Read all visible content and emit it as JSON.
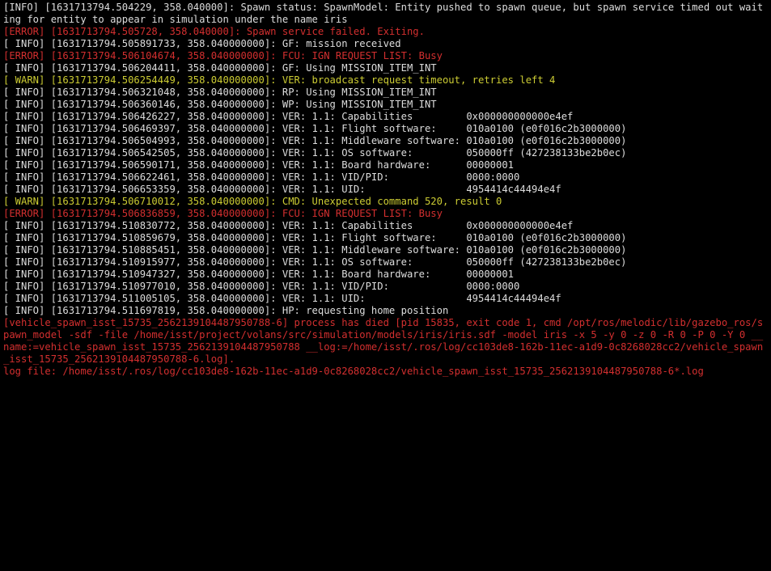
{
  "lines": [
    {
      "cls": "info",
      "text": "[INFO] [1631713794.504229, 358.040000]: Spawn status: SpawnModel: Entity pushed to spawn queue, but spawn service timed out waiting for entity to appear in simulation under the name iris"
    },
    {
      "cls": "error",
      "text": "[ERROR] [1631713794.505728, 358.040000]: Spawn service failed. Exiting."
    },
    {
      "cls": "info",
      "text": "[ INFO] [1631713794.505891733, 358.040000000]: GF: mission received"
    },
    {
      "cls": "error",
      "text": "[ERROR] [1631713794.506104674, 358.040000000]: FCU: IGN REQUEST LIST: Busy"
    },
    {
      "cls": "info",
      "text": "[ INFO] [1631713794.506204411, 358.040000000]: GF: Using MISSION_ITEM_INT"
    },
    {
      "cls": "warn",
      "text": "[ WARN] [1631713794.506254449, 358.040000000]: VER: broadcast request timeout, retries left 4"
    },
    {
      "cls": "info",
      "text": "[ INFO] [1631713794.506321048, 358.040000000]: RP: Using MISSION_ITEM_INT"
    },
    {
      "cls": "info",
      "text": "[ INFO] [1631713794.506360146, 358.040000000]: WP: Using MISSION_ITEM_INT"
    },
    {
      "cls": "info",
      "text": "[ INFO] [1631713794.506426227, 358.040000000]: VER: 1.1: Capabilities         0x000000000000e4ef"
    },
    {
      "cls": "info",
      "text": "[ INFO] [1631713794.506469397, 358.040000000]: VER: 1.1: Flight software:     010a0100 (e0f016c2b3000000)"
    },
    {
      "cls": "info",
      "text": "[ INFO] [1631713794.506504993, 358.040000000]: VER: 1.1: Middleware software: 010a0100 (e0f016c2b3000000)"
    },
    {
      "cls": "info",
      "text": "[ INFO] [1631713794.506542505, 358.040000000]: VER: 1.1: OS software:         050000ff (427238133be2b0ec)"
    },
    {
      "cls": "info",
      "text": "[ INFO] [1631713794.506590171, 358.040000000]: VER: 1.1: Board hardware:      00000001"
    },
    {
      "cls": "info",
      "text": "[ INFO] [1631713794.506622461, 358.040000000]: VER: 1.1: VID/PID:             0000:0000"
    },
    {
      "cls": "info",
      "text": "[ INFO] [1631713794.506653359, 358.040000000]: VER: 1.1: UID:                 4954414c44494e4f"
    },
    {
      "cls": "warn",
      "text": "[ WARN] [1631713794.506710012, 358.040000000]: CMD: Unexpected command 520, result 0"
    },
    {
      "cls": "error",
      "text": "[ERROR] [1631713794.506836859, 358.040000000]: FCU: IGN REQUEST LIST: Busy"
    },
    {
      "cls": "info",
      "text": "[ INFO] [1631713794.510830772, 358.040000000]: VER: 1.1: Capabilities         0x000000000000e4ef"
    },
    {
      "cls": "info",
      "text": "[ INFO] [1631713794.510859679, 358.040000000]: VER: 1.1: Flight software:     010a0100 (e0f016c2b3000000)"
    },
    {
      "cls": "info",
      "text": "[ INFO] [1631713794.510885451, 358.040000000]: VER: 1.1: Middleware software: 010a0100 (e0f016c2b3000000)"
    },
    {
      "cls": "info",
      "text": "[ INFO] [1631713794.510915977, 358.040000000]: VER: 1.1: OS software:         050000ff (427238133be2b0ec)"
    },
    {
      "cls": "info",
      "text": "[ INFO] [1631713794.510947327, 358.040000000]: VER: 1.1: Board hardware:      00000001"
    },
    {
      "cls": "info",
      "text": "[ INFO] [1631713794.510977010, 358.040000000]: VER: 1.1: VID/PID:             0000:0000"
    },
    {
      "cls": "info",
      "text": "[ INFO] [1631713794.511005105, 358.040000000]: VER: 1.1: UID:                 4954414c44494e4f"
    },
    {
      "cls": "info",
      "text": "[ INFO] [1631713794.511697819, 358.040000000]: HP: requesting home position"
    },
    {
      "cls": "fatal",
      "text": "[vehicle_spawn_isst_15735_2562139104487950788-6] process has died [pid 15835, exit code 1, cmd /opt/ros/melodic/lib/gazebo_ros/spawn_model -sdf -file /home/isst/project/volans/src/simulation/models/iris/iris.sdf -model iris -x 5 -y 0 -z 0 -R 0 -P 0 -Y 0 __name:=vehicle_spawn_isst_15735_2562139104487950788 __log:=/home/isst/.ros/log/cc103de8-162b-11ec-a1d9-0c8268028cc2/vehicle_spawn_isst_15735_2562139104487950788-6.log]."
    },
    {
      "cls": "fatal",
      "text": "log file: /home/isst/.ros/log/cc103de8-162b-11ec-a1d9-0c8268028cc2/vehicle_spawn_isst_15735_2562139104487950788-6*.log"
    }
  ]
}
